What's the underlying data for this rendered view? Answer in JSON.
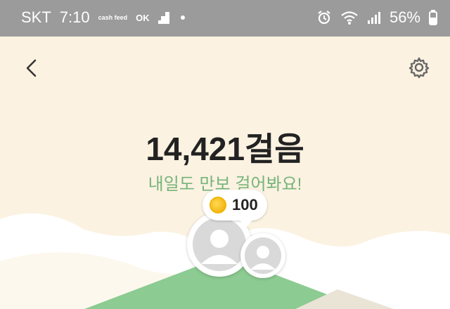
{
  "statusbar": {
    "carrier": "SKT",
    "time": "7:10",
    "cashfeed": "cash feed",
    "ok_label": "OK",
    "battery": "56%"
  },
  "header": {
    "back_icon": "chevron-left-icon",
    "settings_icon": "gear-icon"
  },
  "main": {
    "steps_value": "14,421",
    "steps_unit": "걸음",
    "subtitle": "내일도 만보 걸어봐요!"
  },
  "reward": {
    "coin_icon": "coin-icon",
    "amount": "100"
  },
  "colors": {
    "background": "#fbf2e1",
    "accent_green": "#76b47a",
    "hill_green": "#8ccb91",
    "statusbar": "#9b9b9b"
  }
}
